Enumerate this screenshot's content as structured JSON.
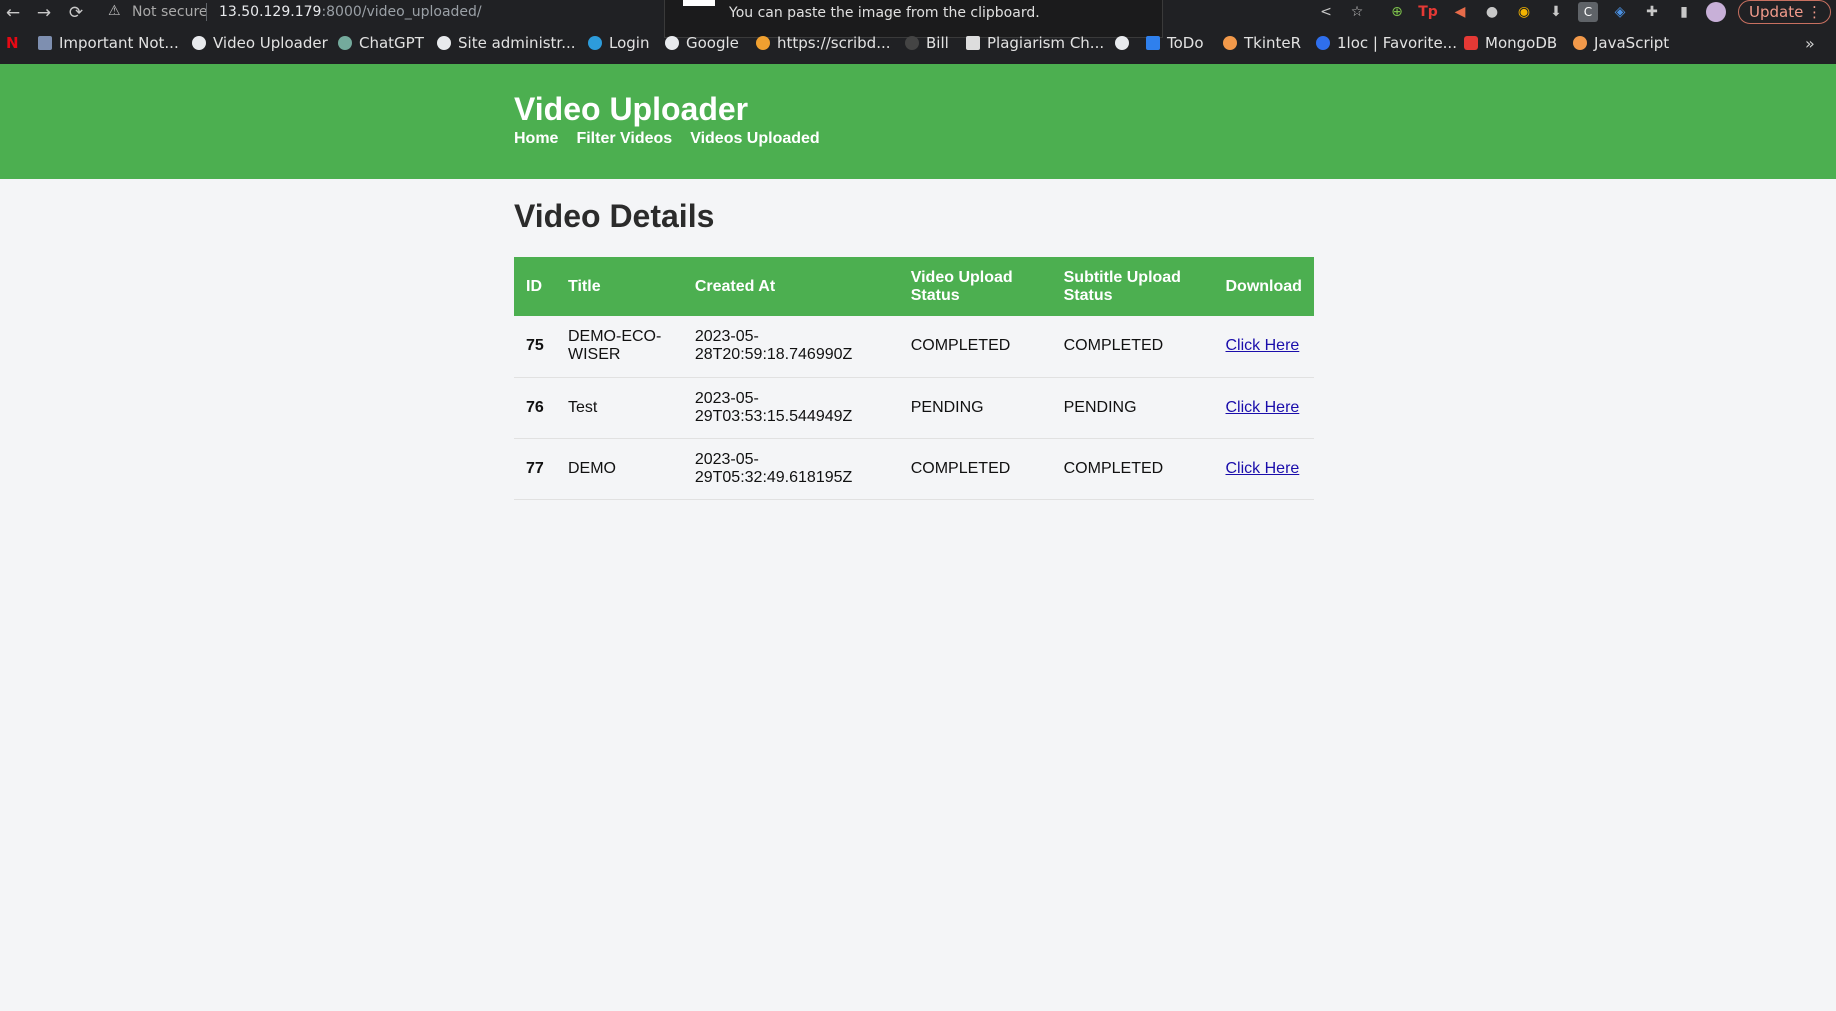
{
  "browser": {
    "back_icon": "←",
    "forward_icon": "→",
    "reload_icon": "⟳",
    "warning_icon": "⚠",
    "security_label": "Not secure",
    "url_host": "13.50.129.179",
    "url_rest": ":8000/video_uploaded/",
    "toast_message": "You can paste the image from the clipboard.",
    "update_label": "Update",
    "menu_icon": "⋮",
    "bookmarks": [
      {
        "label": "Important Not...",
        "color": "#7e8fb0"
      },
      {
        "label": "Video Uploader",
        "color": "#e8eaed"
      },
      {
        "label": "ChatGPT",
        "color": "#74aa9c"
      },
      {
        "label": "Site administr...",
        "color": "#e8eaed"
      },
      {
        "label": "Login",
        "color": "#2d9cdb"
      },
      {
        "label": "Google",
        "color": "#e8eaed"
      },
      {
        "label": "https://scribd...",
        "color": "#f0a030"
      },
      {
        "label": "Bill",
        "color": "#444444"
      },
      {
        "label": "Plagiarism Ch...",
        "color": "#dddddd"
      },
      {
        "label": "",
        "color": "#e8eaed"
      },
      {
        "label": "ToDo",
        "color": "#2f80ed"
      },
      {
        "label": "TkinteR",
        "color": "#f2994a"
      },
      {
        "label": "1loc | Favorite...",
        "color": "#2f6fed"
      },
      {
        "label": "MongoDB",
        "color": "#e53935"
      },
      {
        "label": "JavaScript",
        "color": "#f2994a"
      }
    ],
    "bookmarks_more": "»"
  },
  "header": {
    "title": "Video Uploader",
    "nav": [
      "Home",
      "Filter Videos",
      "Videos Uploaded"
    ]
  },
  "page": {
    "heading": "Video Details"
  },
  "table": {
    "columns": [
      "ID",
      "Title",
      "Created At",
      "Video Upload Status",
      "Subtitle Upload Status",
      "Download"
    ],
    "rows": [
      {
        "id": "75",
        "title": "DEMO-ECO-WISER",
        "created_at": "2023-05-28T20:59:18.746990Z",
        "video_status": "COMPLETED",
        "subtitle_status": "COMPLETED",
        "download": "Click Here"
      },
      {
        "id": "76",
        "title": "Test",
        "created_at": "2023-05-29T03:53:15.544949Z",
        "video_status": "PENDING",
        "subtitle_status": "PENDING",
        "download": "Click Here"
      },
      {
        "id": "77",
        "title": "DEMO",
        "created_at": "2023-05-29T05:32:49.618195Z",
        "video_status": "COMPLETED",
        "subtitle_status": "COMPLETED",
        "download": "Click Here"
      }
    ]
  },
  "colors": {
    "header_green": "#4caf50",
    "page_bg": "#f4f5f7",
    "link": "#1a0dab"
  }
}
